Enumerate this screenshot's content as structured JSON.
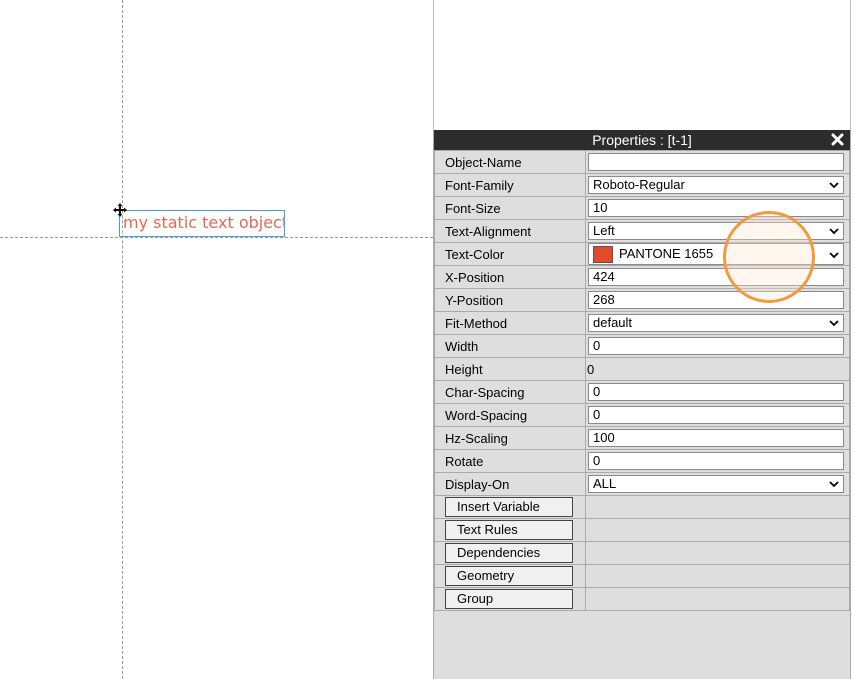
{
  "canvas": {
    "text_object": "my static text object"
  },
  "properties": {
    "title": "Properties : [t-1]",
    "rows": [
      {
        "label": "Object-Name",
        "value": ""
      },
      {
        "label": "Font-Family",
        "value": "Roboto-Regular"
      },
      {
        "label": "Font-Size",
        "value": "10"
      },
      {
        "label": "Text-Alignment",
        "value": "Left"
      },
      {
        "label": "Text-Color",
        "value": "PANTONE 1655"
      },
      {
        "label": "X-Position",
        "value": "424"
      },
      {
        "label": "Y-Position",
        "value": "268"
      },
      {
        "label": "Fit-Method",
        "value": "default"
      },
      {
        "label": "Width",
        "value": "0"
      },
      {
        "label": "Height",
        "value": "0"
      },
      {
        "label": "Char-Spacing",
        "value": "0"
      },
      {
        "label": "Word-Spacing",
        "value": "0"
      },
      {
        "label": "Hz-Scaling",
        "value": "100"
      },
      {
        "label": "Rotate",
        "value": "0"
      },
      {
        "label": "Display-On",
        "value": "ALL"
      }
    ],
    "buttons": [
      "Insert Variable",
      "Text Rules",
      "Dependencies",
      "Geometry",
      "Group"
    ]
  },
  "colors": {
    "text_color_swatch": "#e24a2c",
    "text_object": "#e36a4f",
    "selection_border": "#4a9fd8"
  }
}
